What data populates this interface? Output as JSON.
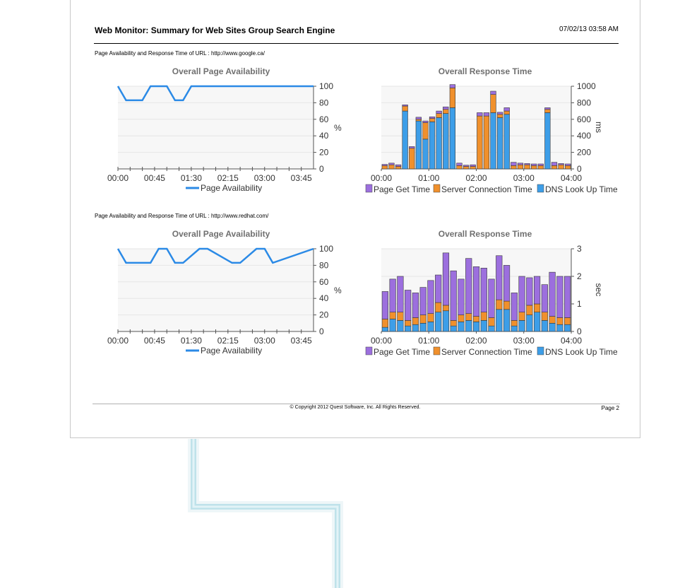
{
  "report": {
    "title": "Web Monitor: Summary for Web Sites Group Search Engine",
    "date": "07/02/13 03:58 AM",
    "footer": "© Copyright 2012 Quest Software, Inc. All Rights Reserved.",
    "page": "Page 2"
  },
  "sections": [
    {
      "url_label": "Page Availability and Response Time of URL : http://www.google.ca/"
    },
    {
      "url_label": "Page Availability and Response Time of URL : http://www.redhat.com/"
    }
  ],
  "colors": {
    "availability": "#2b8ae6",
    "page_get": "#9c6fde",
    "server_conn": "#f0902c",
    "dns": "#3d9ee8"
  },
  "chart_data": [
    {
      "type": "line",
      "title": "Overall Page Availability",
      "ylabel": "%",
      "ylim": [
        0,
        100
      ],
      "yticks": [
        0,
        20,
        40,
        60,
        80,
        100
      ],
      "xticks": [
        "00:00",
        "00:45",
        "01:30",
        "02:15",
        "03:00",
        "03:45"
      ],
      "x_minutes": [
        0,
        10,
        30,
        40,
        60,
        70,
        80,
        90,
        100,
        240
      ],
      "series": [
        {
          "name": "Page Availability",
          "values": [
            100,
            83,
            83,
            100,
            100,
            83,
            83,
            100,
            100,
            100
          ]
        }
      ],
      "legend": "bottom",
      "grid": true
    },
    {
      "type": "bar",
      "stacked": true,
      "title": "Overall Response Time",
      "ylabel": "ms",
      "ylim": [
        0,
        1000
      ],
      "yticks": [
        0,
        200,
        400,
        600,
        800,
        1000
      ],
      "xticks": [
        "00:00",
        "01:00",
        "02:00",
        "03:00",
        "04:00"
      ],
      "series": [
        {
          "name": "Page Get Time",
          "values": [
            15,
            20,
            20,
            15,
            20,
            25,
            20,
            20,
            30,
            30,
            40,
            30,
            15,
            20,
            40,
            40,
            40,
            25,
            40,
            40,
            20,
            15,
            20,
            20,
            20,
            40,
            15,
            20
          ]
        },
        {
          "name": "Server Connection Time",
          "values": [
            40,
            50,
            30,
            60,
            250,
            20,
            200,
            40,
            50,
            50,
            240,
            40,
            30,
            30,
            640,
            640,
            220,
            40,
            40,
            40,
            50,
            50,
            40,
            40,
            40,
            40,
            50,
            40
          ]
        },
        {
          "name": "DNS Look Up Time",
          "values": [
            0,
            0,
            0,
            700,
            0,
            580,
            360,
            570,
            620,
            670,
            740,
            0,
            0,
            0,
            0,
            0,
            680,
            620,
            660,
            0,
            0,
            0,
            0,
            0,
            680,
            0,
            0,
            0
          ]
        }
      ],
      "legend": "bottom",
      "grid": true
    },
    {
      "type": "line",
      "title": "Overall Page Availability",
      "ylabel": "%",
      "ylim": [
        0,
        100
      ],
      "yticks": [
        0,
        20,
        40,
        60,
        80,
        100
      ],
      "xticks": [
        "00:00",
        "00:45",
        "01:30",
        "02:15",
        "03:00",
        "03:45"
      ],
      "x_minutes": [
        0,
        10,
        40,
        50,
        60,
        70,
        80,
        100,
        110,
        140,
        150,
        170,
        180,
        190,
        240
      ],
      "series": [
        {
          "name": "Page Availability",
          "values": [
            100,
            83,
            83,
            100,
            100,
            83,
            83,
            100,
            100,
            83,
            83,
            100,
            100,
            83,
            100
          ]
        }
      ],
      "legend": "bottom",
      "grid": true
    },
    {
      "type": "bar",
      "stacked": true,
      "title": "Overall Response Time",
      "ylabel": "sec",
      "ylim": [
        0,
        3
      ],
      "yticks": [
        0,
        1,
        2,
        3
      ],
      "xticks": [
        "00:00",
        "01:00",
        "02:00",
        "03:00",
        "04:00"
      ],
      "series": [
        {
          "name": "Page Get Time",
          "values": [
            1.0,
            1.2,
            1.3,
            1.1,
            0.9,
            1.0,
            1.2,
            1.0,
            1.9,
            1.8,
            1.3,
            2.0,
            1.8,
            1.6,
            1.4,
            1.6,
            1.3,
            1.0,
            1.3,
            1.0,
            1.0,
            1.0,
            1.6,
            1.5,
            1.5
          ]
        },
        {
          "name": "Server Connection Time",
          "values": [
            0.3,
            0.25,
            0.3,
            0.2,
            0.25,
            0.3,
            0.3,
            0.35,
            0.2,
            0.2,
            0.25,
            0.25,
            0.2,
            0.3,
            0.3,
            0.35,
            0.3,
            0.2,
            0.3,
            0.35,
            0.3,
            0.3,
            0.25,
            0.25,
            0.25
          ]
        },
        {
          "name": "DNS Look Up Time",
          "values": [
            0.15,
            0.45,
            0.4,
            0.2,
            0.25,
            0.3,
            0.35,
            0.7,
            0.75,
            0.2,
            0.35,
            0.4,
            0.35,
            0.4,
            0.2,
            0.8,
            0.8,
            0.2,
            0.4,
            0.6,
            0.7,
            0.4,
            0.3,
            0.25,
            0.25
          ]
        }
      ],
      "legend": "bottom",
      "grid": true
    }
  ]
}
